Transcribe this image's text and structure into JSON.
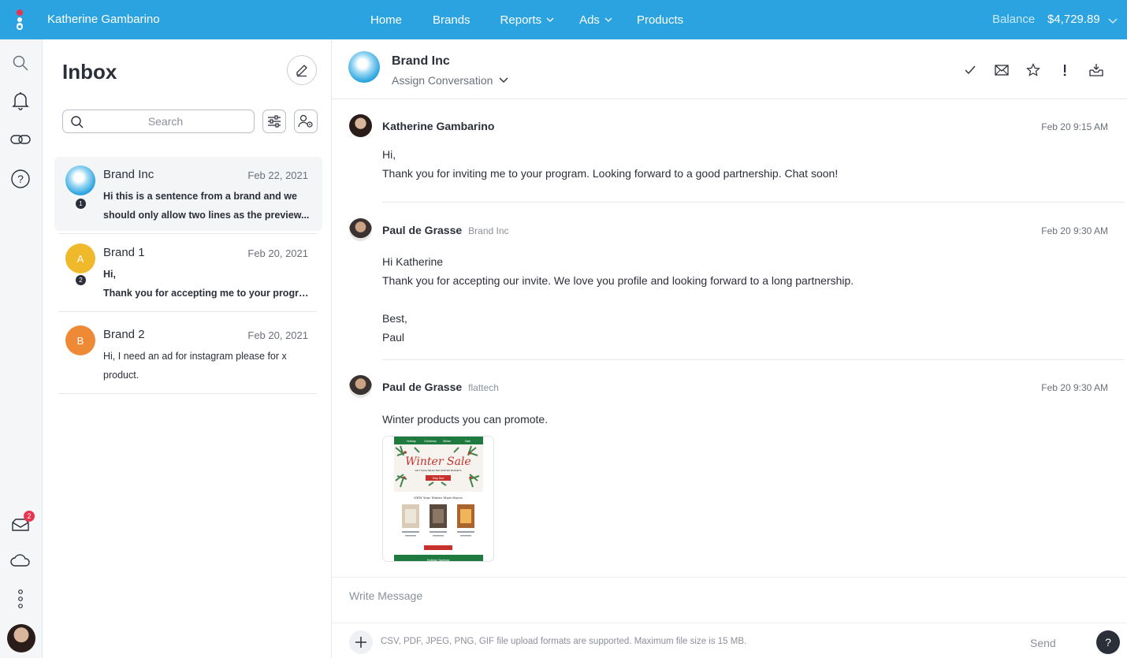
{
  "topbar": {
    "user_name": "Katherine Gambarino",
    "nav": [
      {
        "label": "Home",
        "has_dropdown": false
      },
      {
        "label": "Brands",
        "has_dropdown": false
      },
      {
        "label": "Reports",
        "has_dropdown": true
      },
      {
        "label": "Ads",
        "has_dropdown": true
      },
      {
        "label": "Products",
        "has_dropdown": false
      }
    ],
    "balance_label": "Balance",
    "balance_value": "$4,729.89"
  },
  "rail": {
    "icons": [
      "search-icon",
      "bell-icon",
      "link-icon",
      "help-circle-icon",
      "mail-icon",
      "cloud-icon",
      "more-vertical-icon"
    ],
    "mail_badge": "2"
  },
  "inbox": {
    "title": "Inbox",
    "search_placeholder": "Search",
    "conversations": [
      {
        "name": "Brand Inc",
        "date": "Feb 22, 2021",
        "count": "1",
        "avatar_letter": "",
        "avatar_color": "#2aa3e0",
        "preview_lines": [
          "Hi this is a sentence from a brand and we",
          "should only allow two lines as the preview..."
        ],
        "bold": true
      },
      {
        "name": "Brand 1",
        "date": "Feb 20, 2021",
        "count": "2",
        "avatar_letter": "A",
        "avatar_color": "#f0b92b",
        "preview_lines": [
          "Hi,",
          "Thank you for accepting me to your progra..."
        ],
        "bold": true
      },
      {
        "name": "Brand 2",
        "date": "Feb 20, 2021",
        "count": "",
        "avatar_letter": "B",
        "avatar_color": "#ee8a35",
        "preview_lines": [
          "Hi, I need an ad for instagram please for x",
          "product."
        ],
        "bold": false
      }
    ]
  },
  "chat": {
    "title": "Brand Inc",
    "assign_label": "Assign Conversation",
    "header_icons": [
      "check-icon",
      "envelope-icon",
      "star-icon",
      "exclamation-icon",
      "inbox-download-icon"
    ],
    "messages": [
      {
        "sender": "Katherine Gambarino",
        "org": "",
        "time": "Feb 20 9:15 AM",
        "lines": [
          "Hi,",
          "Thank you for inviting me to your program. Looking forward to a good partnership. Chat soon!"
        ]
      },
      {
        "sender": "Paul de Grasse",
        "org": "Brand Inc",
        "time": "Feb 20 9:30 AM",
        "lines": [
          "Hi Katherine",
          "Thank you for accepting our invite. We love you profile and looking forward to a long partnership.",
          "",
          "Best,",
          "Paul"
        ]
      },
      {
        "sender": "Paul de Grasse",
        "org": "flattech",
        "time": "Feb 20 9:30 AM",
        "lines": [
          "Winter products you can promote."
        ]
      }
    ],
    "attachment": {
      "headline": "Winter Sale",
      "subheadline": "GIFT SALE SELECTED WINTER BASKETS",
      "cta": "Shop Now",
      "section_title": "NEW Your Winter Must-Haves",
      "footer": "Holiday Savings",
      "nav_items": [
        "Holiday",
        "Christmas",
        "Winter",
        "Sale"
      ]
    },
    "composer_placeholder": "Write Message",
    "upload_note": "CSV, PDF, JPEG, PNG, GIF file upload formats are supported. Maximum file size is 15 MB.",
    "send_label": "Send",
    "help_label": "?"
  },
  "colors": {
    "brand_blue": "#2aa3e0",
    "badge_red": "#e8344e",
    "dark": "#2b2f3a"
  }
}
